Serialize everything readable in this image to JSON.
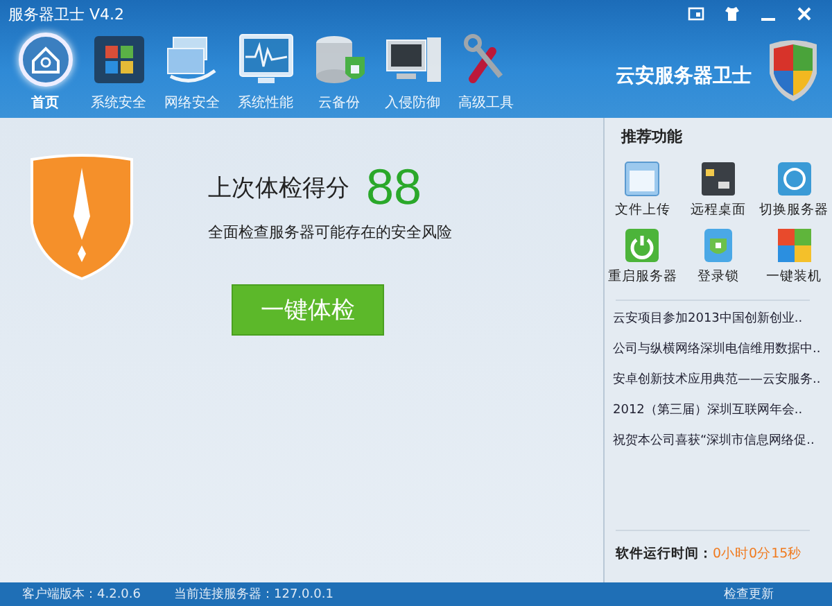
{
  "window": {
    "title": "服务器卫士 V4.2"
  },
  "nav": [
    {
      "label": "首页",
      "selected": true
    },
    {
      "label": "系统安全",
      "selected": false
    },
    {
      "label": "网络安全",
      "selected": false
    },
    {
      "label": "系统性能",
      "selected": false
    },
    {
      "label": "云备份",
      "selected": false
    },
    {
      "label": "入侵防御",
      "selected": false
    },
    {
      "label": "高级工具",
      "selected": false
    }
  ],
  "brand": "云安服务器卫士",
  "checkup": {
    "score_label": "上次体检得分",
    "score": "88",
    "description": "全面检查服务器可能存在的安全风险",
    "button": "一键体检"
  },
  "recommended": {
    "title": "推荐功能",
    "items": [
      "文件上传",
      "远程桌面",
      "切换服务器",
      "重启服务器",
      "登录锁",
      "一键装机"
    ]
  },
  "news": [
    "云安项目参加2013中国创新创业..",
    "公司与纵横网络深圳电信维用数据中..",
    "安卓创新技术应用典范——云安服务..",
    "2012（第三届）深圳互联网年会..",
    "祝贺本公司喜获“深圳市信息网络促.."
  ],
  "runtime": {
    "label": "软件运行时间：",
    "value": "0小时0分15秒"
  },
  "status_bar": {
    "version": "客户端版本：4.2.0.6",
    "server": "当前连接服务器：127.0.0.1",
    "update": "检查更新"
  }
}
